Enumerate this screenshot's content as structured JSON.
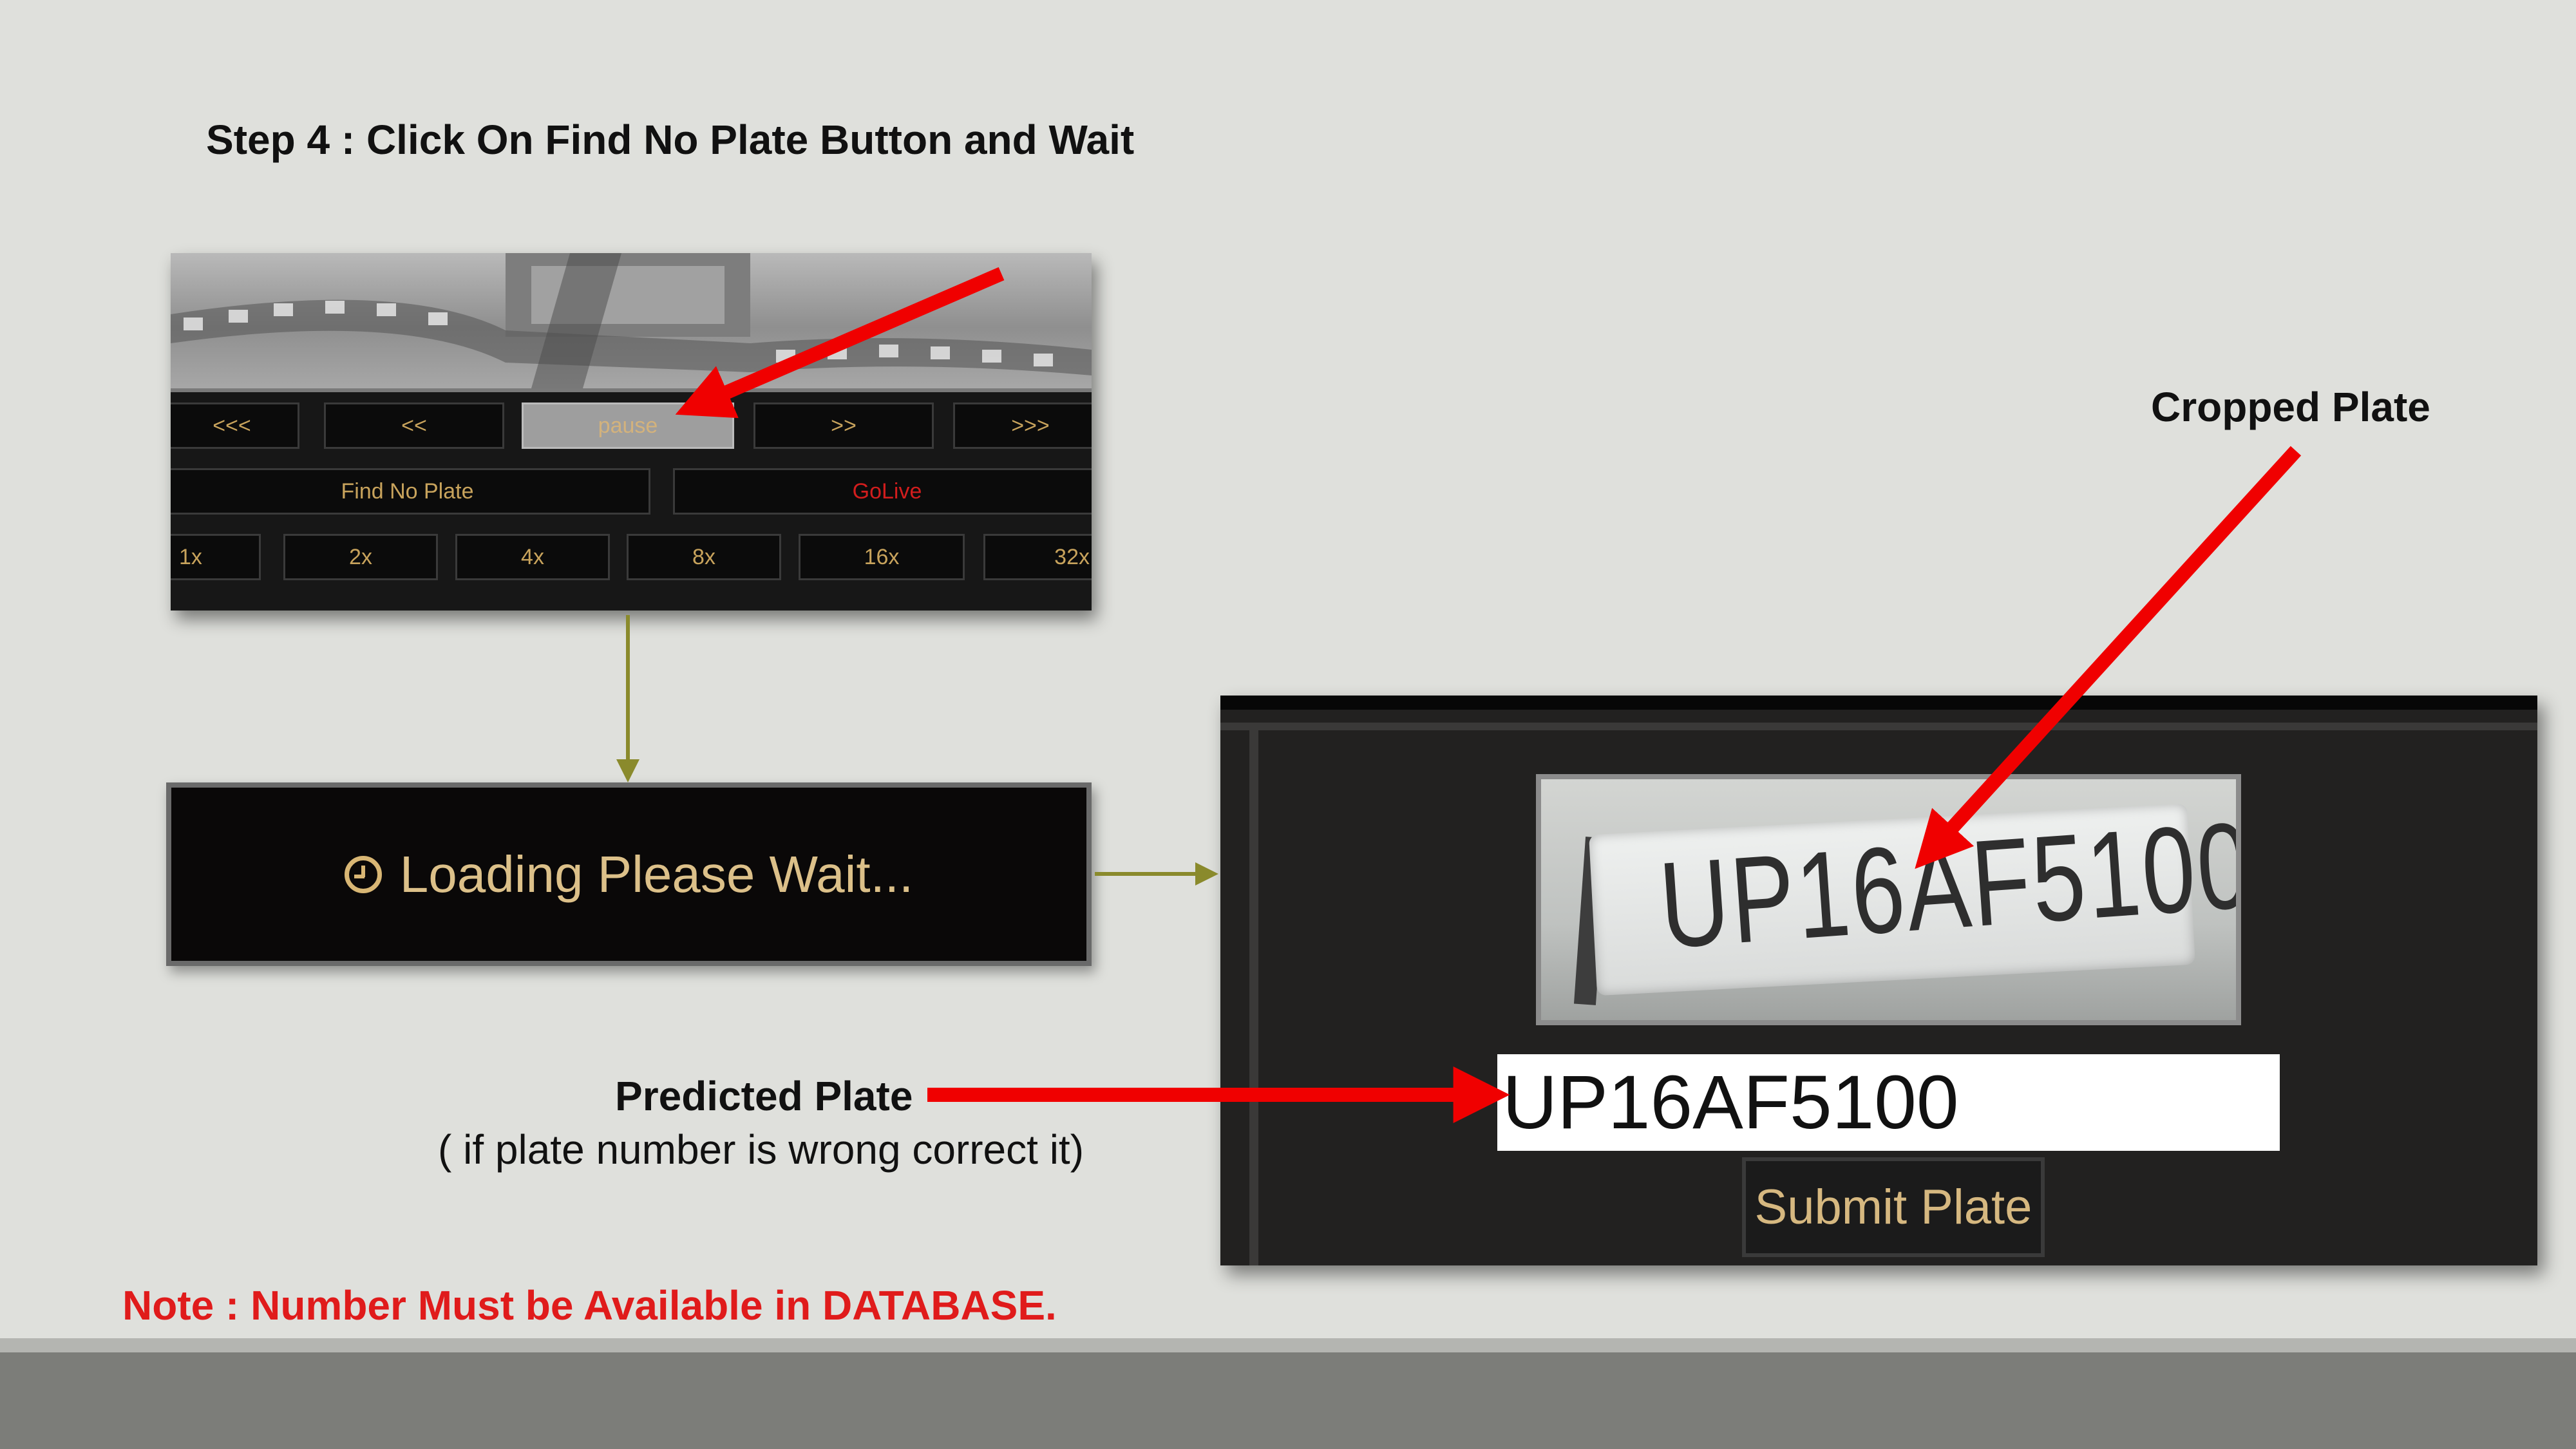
{
  "slide": {
    "step_title": "Step 4 : Click On Find No Plate Button and Wait",
    "cropped_plate_label": "Cropped Plate",
    "predicted_plate_label": "Predicted Plate",
    "predicted_plate_hint": "( if plate number is wrong correct it)",
    "note": "Note : Number Must be Available in DATABASE."
  },
  "player": {
    "nav_buttons": [
      "<<<",
      "<<",
      "pause",
      ">>",
      ">>>"
    ],
    "active_nav": "pause",
    "find_no_plate_label": "Find No Plate",
    "golive_label": "GoLive",
    "speed_buttons": [
      "1x",
      "2x",
      "4x",
      "8x",
      "16x",
      "32x"
    ]
  },
  "loading": {
    "icon": "clock-icon",
    "text": "Loading Please Wait..."
  },
  "plate_panel": {
    "cropped_plate_text": "UP16AF5100",
    "predicted_value": "UP16AF5100",
    "submit_label": "Submit Plate"
  },
  "colors": {
    "arrow_red": "#f00000",
    "connector_olive": "#8a8a2c",
    "button_text_gold": "#c8a35c",
    "golive_red": "#d21d1d",
    "note_red": "#e01b1b"
  }
}
